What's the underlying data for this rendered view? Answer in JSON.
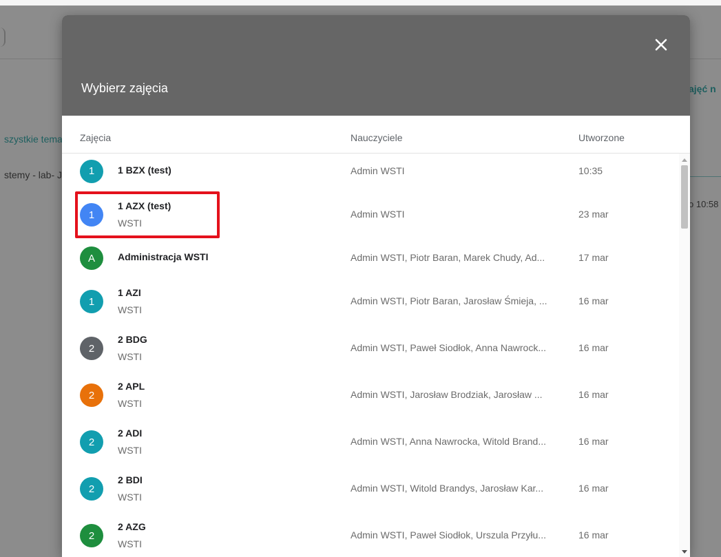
{
  "background": {
    "left_link": "szystkie tema",
    "left_text": "stemy - lab- J",
    "right_link": "ajęć n",
    "right_time": "o 10:58"
  },
  "dialog": {
    "title": "Wybierz zajęcia",
    "close_icon": "close-icon",
    "columns": {
      "class": "Zajęcia",
      "teachers": "Nauczyciele",
      "created": "Utworzone"
    },
    "rows": [
      {
        "letter": "1",
        "color": "#129eaf",
        "name": "1 BZX (test)",
        "sub": "",
        "teachers": "Admin WSTI",
        "created": "10:35"
      },
      {
        "letter": "1",
        "color": "#4285f4",
        "name": "1 AZX (test)",
        "sub": "WSTI",
        "teachers": "Admin WSTI",
        "created": "23 mar"
      },
      {
        "letter": "A",
        "color": "#1e8e3e",
        "name": "Administracja WSTI",
        "sub": "",
        "teachers": "Admin WSTI, Piotr Baran, Marek Chudy, Ad...",
        "created": "17 mar"
      },
      {
        "letter": "1",
        "color": "#129eaf",
        "name": "1 AZI",
        "sub": "WSTI",
        "teachers": "Admin WSTI, Piotr Baran, Jarosław Śmieja, ...",
        "created": "16 mar"
      },
      {
        "letter": "2",
        "color": "#5f6368",
        "name": "2 BDG",
        "sub": "WSTI",
        "teachers": "Admin WSTI, Paweł Siodłok, Anna Nawrock...",
        "created": "16 mar"
      },
      {
        "letter": "2",
        "color": "#e8710a",
        "name": "2 APL",
        "sub": "WSTI",
        "teachers": "Admin WSTI, Jarosław Brodziak, Jarosław ...",
        "created": "16 mar"
      },
      {
        "letter": "2",
        "color": "#129eaf",
        "name": "2 ADI",
        "sub": "WSTI",
        "teachers": "Admin WSTI, Anna Nawrocka, Witold Brand...",
        "created": "16 mar"
      },
      {
        "letter": "2",
        "color": "#129eaf",
        "name": "2 BDI",
        "sub": "WSTI",
        "teachers": "Admin WSTI, Witold Brandys, Jarosław Kar...",
        "created": "16 mar"
      },
      {
        "letter": "2",
        "color": "#1e8e3e",
        "name": "2 AZG",
        "sub": "WSTI",
        "teachers": "Admin WSTI, Paweł Siodłok, Urszula Przyłu...",
        "created": "16 mar"
      }
    ]
  }
}
